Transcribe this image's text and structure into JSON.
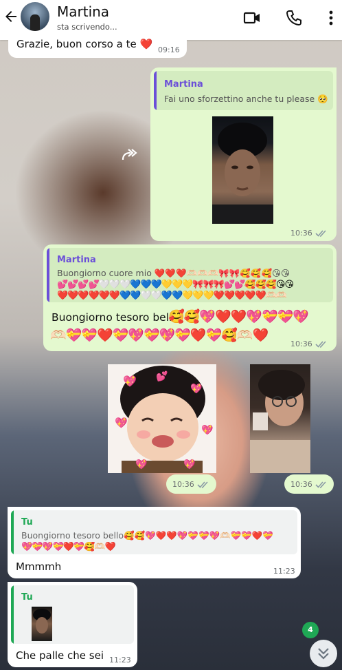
{
  "header": {
    "name": "Martina",
    "status": "sta scrivendo..."
  },
  "messages": {
    "m0": {
      "text": "Grazie, buon corso a te ❤️",
      "time": "09:16"
    },
    "m1": {
      "quote_name": "Martina",
      "quote_text": "Fai uno sforzettino anche tu please 🥺",
      "time": "10:36"
    },
    "m2": {
      "quote_name": "Martina",
      "quote_line1": "Buongiorno cuore mio ❤️❤️❤️🫶🏻🫶🏻🫶🏻🎀🎀🥰🥰🥰😘😘",
      "quote_line2": "💕💕💕💕🤍🤍🤍💙💙💙💛💛💛🎀🎀🎀💕💕🥰🥰🥰😘😘",
      "quote_line3": "❤️❤️❤️❤️❤️❤️💙💙🤍🤍💙💙💛💛💛❤️❤️❤️❤️❤️🫶🏻🫶🏻",
      "text": "Buongiorno  tesoro bello",
      "emoji1": "🥰🥰💖❤️❤️💖💝💝💖",
      "emoji2": "🫶🏻💝💝❤️💝💖💝💖💝❤️💝🥰🫶🏻❤️",
      "time": "10:36"
    },
    "m3": {
      "time": "10:36"
    },
    "m4": {
      "time": "10:36"
    },
    "m5": {
      "quote_name": "Tu",
      "quote_line1": "Buongiorno  tesoro bello🥰🥰💖❤️❤️💖💝💝💖🫶🏻💝💝❤️💝",
      "quote_line2": "💖💝💖💝❤️💝🥰🫶🏻❤️",
      "text": "Mmmmh",
      "time": "11:23"
    },
    "m6": {
      "quote_name": "Tu",
      "text": "Che palle che sei",
      "time": "11:23"
    }
  },
  "unread_badge": "4",
  "colors": {
    "outgoing_bubble": "#e4f9cf",
    "incoming_bubble": "#ffffff",
    "quote_martina": "#6b4fd8",
    "quote_tu": "#1fa855",
    "read_ticks": "#8a9aa5"
  },
  "icons": [
    "back-arrow-icon",
    "video-call-icon",
    "phone-icon",
    "more-vert-icon",
    "forward-icon",
    "double-check-icon",
    "scroll-down-icon"
  ]
}
